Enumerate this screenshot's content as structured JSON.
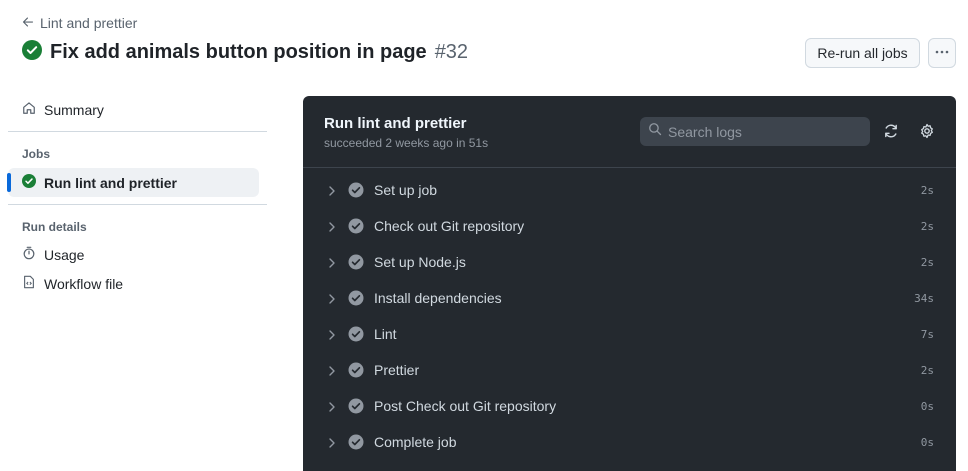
{
  "header": {
    "back_label": "Lint and prettier",
    "title": "Fix add animals button position in page",
    "run_number": "#32",
    "rerun_label": "Re-run all jobs",
    "status_color": "#1a7f37"
  },
  "sidebar": {
    "summary_label": "Summary",
    "jobs_label": "Jobs",
    "job_label": "Run lint and prettier",
    "run_details_label": "Run details",
    "usage_label": "Usage",
    "workflow_label": "Workflow file"
  },
  "log": {
    "job_title": "Run lint and prettier",
    "status": "succeeded 2 weeks ago in 51s",
    "search_placeholder": "Search logs",
    "steps": [
      {
        "name": "Set up job",
        "duration": "2s"
      },
      {
        "name": "Check out Git repository",
        "duration": "2s"
      },
      {
        "name": "Set up Node.js",
        "duration": "2s"
      },
      {
        "name": "Install dependencies",
        "duration": "34s"
      },
      {
        "name": "Lint",
        "duration": "7s"
      },
      {
        "name": "Prettier",
        "duration": "2s"
      },
      {
        "name": "Post Check out Git repository",
        "duration": "0s"
      },
      {
        "name": "Complete job",
        "duration": "0s"
      }
    ]
  },
  "colors": {
    "accent": "#0969da",
    "success": "#1a7f37",
    "log_background": "#24292f"
  }
}
